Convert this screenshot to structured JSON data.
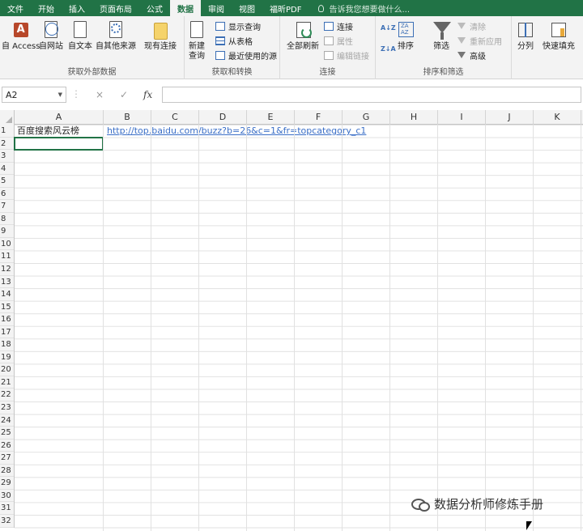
{
  "menu": {
    "tabs": [
      "文件",
      "开始",
      "插入",
      "页面布局",
      "公式",
      "数据",
      "审阅",
      "视图",
      "福昕PDF"
    ],
    "active_index": 5,
    "tell_me": "告诉我您想要做什么..."
  },
  "ribbon": {
    "get_external": {
      "label": "获取外部数据",
      "access": "自 Access",
      "web": "自网站",
      "text": "自文本",
      "other": "自其他来源",
      "existing": "现有连接"
    },
    "get_transform": {
      "label": "获取和转换",
      "new_query_line1": "新建",
      "new_query_line2": "查询",
      "show_queries": "显示查询",
      "from_table": "从表格",
      "recent_sources": "最近使用的源"
    },
    "connections": {
      "label": "连接",
      "refresh_all": "全部刷新",
      "connections": "连接",
      "properties": "属性",
      "edit_links": "编辑链接"
    },
    "sort_filter": {
      "label": "排序和筛选",
      "sort": "排序",
      "filter": "筛选",
      "clear": "清除",
      "reapply": "重新应用",
      "advanced": "高级"
    },
    "data_tools": {
      "text_to_columns": "分列",
      "flash_fill": "快速填充"
    }
  },
  "formula_bar": {
    "name_box": "A2",
    "cancel_icon": "×",
    "enter_icon": "✓",
    "fx_icon": "fx",
    "content": ""
  },
  "sheet": {
    "columns": [
      "A",
      "B",
      "C",
      "D",
      "E",
      "F",
      "G",
      "H",
      "I",
      "J",
      "K"
    ],
    "rows": [
      "1",
      "2",
      "3",
      "4",
      "5",
      "6",
      "7",
      "8",
      "9",
      "10",
      "11",
      "12",
      "13",
      "14",
      "15",
      "16",
      "17",
      "18",
      "19",
      "20",
      "21",
      "22",
      "23",
      "24",
      "25",
      "26",
      "27",
      "28",
      "29",
      "30",
      "31",
      "32"
    ],
    "cells": {
      "A1": "百度搜索风云榜",
      "B1": "http://top.baidu.com/buzz?b=26&c=1&fr=topcategory_c1"
    },
    "selected_cell": "A2",
    "selection_color": "#217346"
  },
  "watermark": "数据分析师修炼手册",
  "colors": {
    "accent": "#217346",
    "link": "#3b6fc7"
  }
}
